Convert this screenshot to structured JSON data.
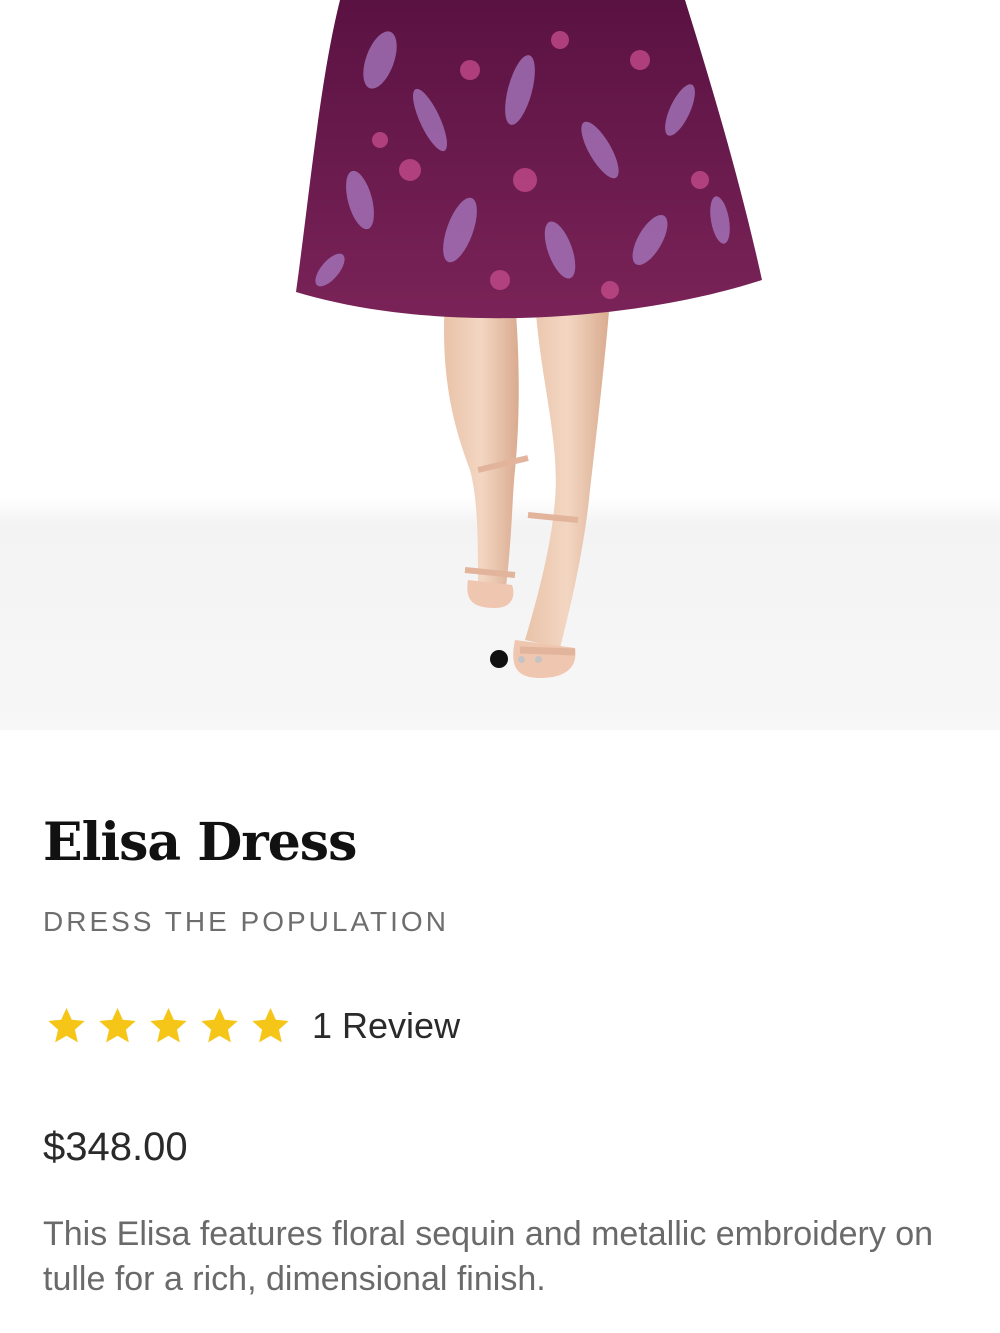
{
  "product": {
    "image_alt": "Elisa Dress",
    "carousel": {
      "current": 1,
      "total": 3
    },
    "title": "Elisa Dress",
    "brand": "DRESS THE POPULATION",
    "rating": 5,
    "rating_max": 5,
    "review_label": "1 Review",
    "price": "$348.00",
    "description": "This Elisa features floral sequin and metallic embroidery on tulle for a rich, dimensional finish."
  },
  "colors": {
    "star": "#F5C518",
    "dress": "#6B1A4E",
    "dress_pattern": "#A77AC0"
  },
  "icons": {
    "star": "star-icon"
  }
}
